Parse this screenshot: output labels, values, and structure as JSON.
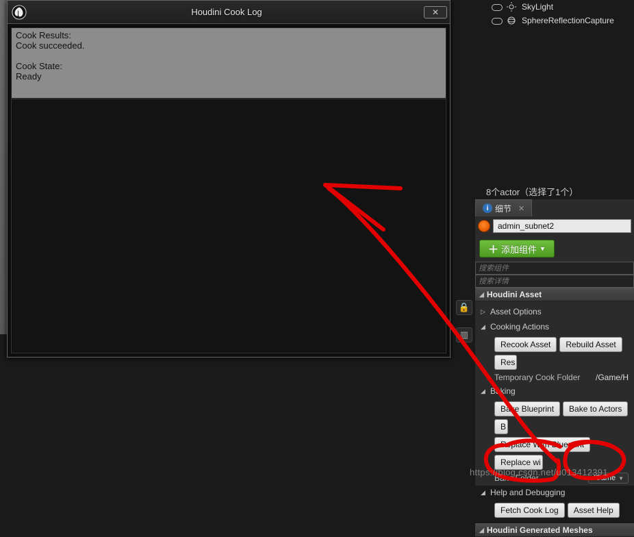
{
  "dialog": {
    "title": "Houdini Cook Log",
    "log_text": "Cook Results:\nCook succeeded.\n\nCook State:\nReady"
  },
  "outliner": {
    "rows": [
      {
        "label": "SkyLight"
      },
      {
        "label": "SphereReflectionCapture"
      }
    ],
    "footer": "8个actor（选择了1个）"
  },
  "details": {
    "tab_label": "细节",
    "object_name": "admin_subnet2",
    "add_component_label": "添加组件",
    "search_components_placeholder": "搜索组件",
    "search_details_placeholder": "搜索详情",
    "sections": {
      "houdini_asset": {
        "title": "Houdini Asset",
        "asset_options_label": "Asset Options",
        "cooking_actions_label": "Cooking Actions",
        "buttons": {
          "recook": "Recook Asset",
          "rebuild": "Rebuild Asset",
          "reset_cut": "Res"
        },
        "temp_cook_folder_label": "Temporary Cook Folder",
        "temp_cook_folder_value": "/Game/H"
      },
      "baking": {
        "title": "Baking",
        "buttons": {
          "bake_blueprint": "Bake Blueprint",
          "bake_actors": "Bake to Actors",
          "bake_cut": "B",
          "replace_blueprint": "Replace With Blueprint",
          "replace_cut": "Replace wi"
        },
        "bake_folder_label": "Bake Folder",
        "bake_folder_value": "/Game"
      },
      "help_debug": {
        "title": "Help and Debugging",
        "buttons": {
          "fetch_log": "Fetch Cook Log",
          "asset_help": "Asset Help"
        }
      },
      "gen_meshes": {
        "title": "Houdini Generated Meshes"
      }
    }
  },
  "watermark": "https://blog.csdn.net/u013412391"
}
